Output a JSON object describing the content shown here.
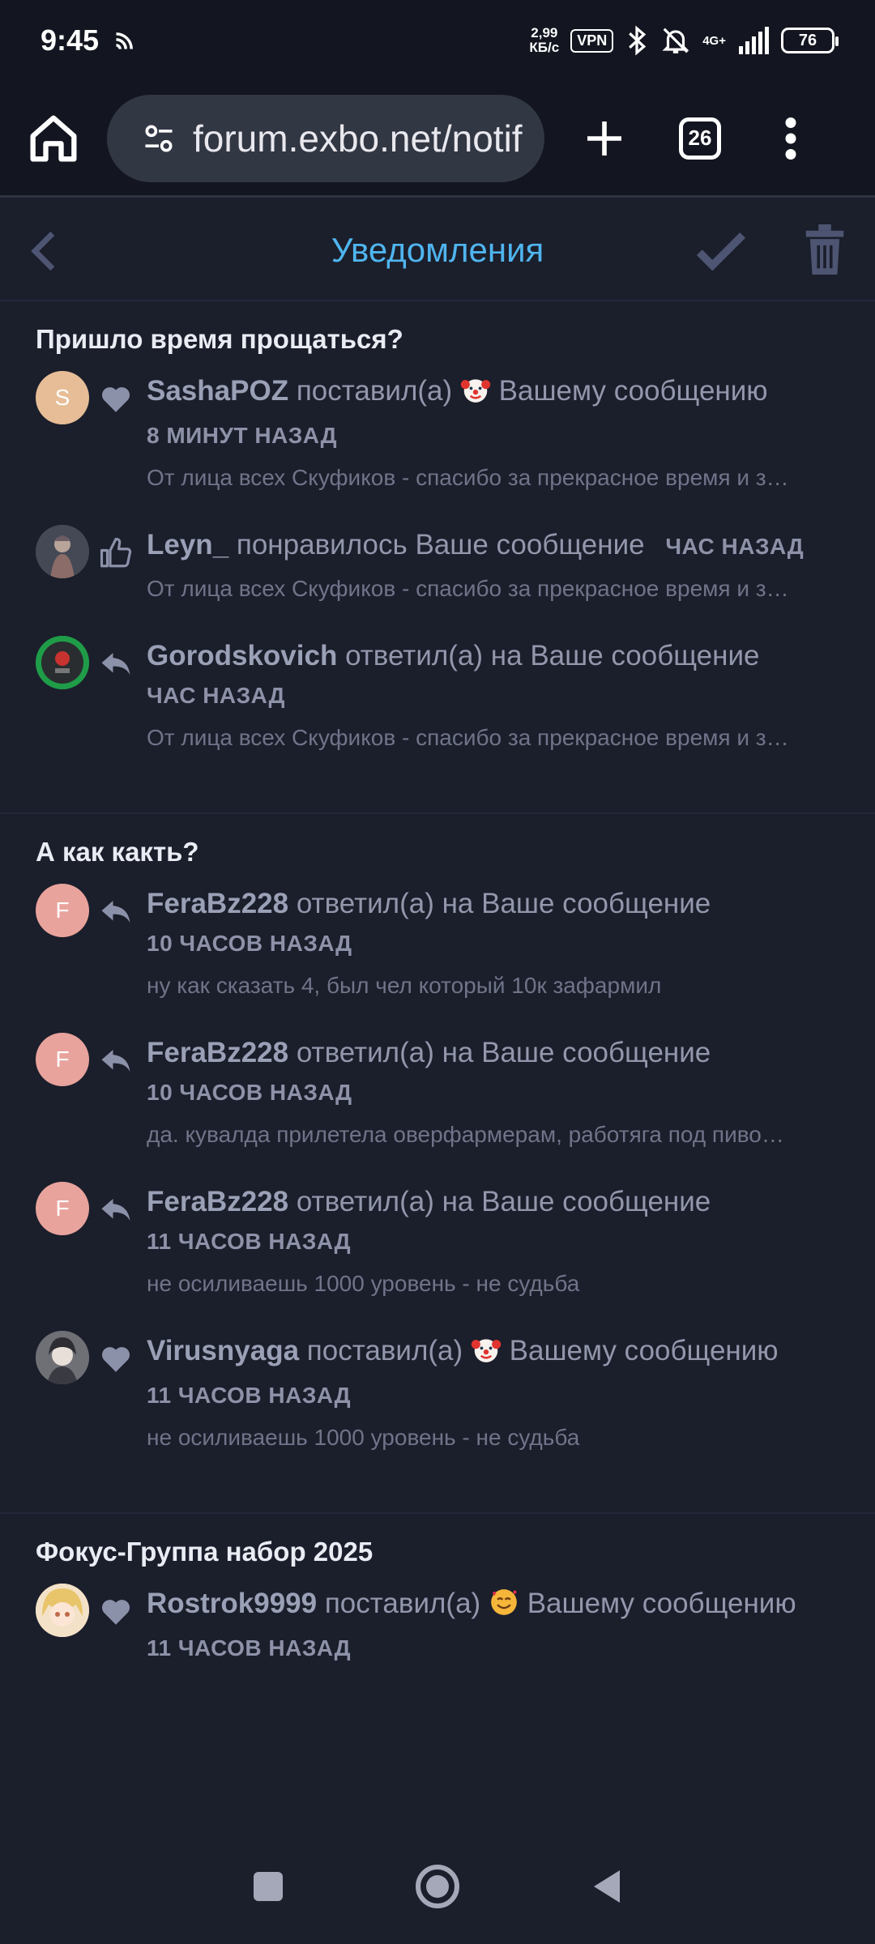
{
  "status_bar": {
    "time": "9:45",
    "speed_value": "2,99",
    "speed_unit": "КБ/с",
    "vpn": "VPN",
    "network": "4G+",
    "battery": "76"
  },
  "browser": {
    "url": "forum.exbo.net/notif",
    "tab_count": "26"
  },
  "header": {
    "title": "Уведомления"
  },
  "colors": {
    "accent": "#4fb5ef",
    "background": "#1b1e2b"
  },
  "groups": [
    {
      "title": "Пришло время прощаться?",
      "items": [
        {
          "user": "SashaPOZ",
          "action_before": "поставил(а)",
          "emoji": "clown",
          "action_after": "Вашему сообщению",
          "time": "8 минут назад",
          "excerpt": "От лица всех Скуфиков - спасибо за прекрасное время и з…",
          "icon": "heart-icon",
          "avatar_letter": "S"
        },
        {
          "user": "Leyn_",
          "action_before": "понравилось Ваше сообщение",
          "time": "час назад",
          "excerpt": "От лица всех Скуфиков - спасибо за прекрасное время и з…",
          "icon": "thumbs-up-icon"
        },
        {
          "user": "Gorodskovich",
          "action_before": "ответил(а) на Ваше сообщение",
          "time": "час назад",
          "excerpt": "От лица всех Скуфиков - спасибо за прекрасное время и з…",
          "icon": "reply-icon"
        }
      ]
    },
    {
      "title": "А как какть?",
      "items": [
        {
          "user": "FeraBz228",
          "action_before": "ответил(а) на Ваше сообщение",
          "time": "10 часов назад",
          "excerpt": "ну как сказать 4, был чел который 10к зафармил",
          "icon": "reply-icon",
          "avatar_letter": "F"
        },
        {
          "user": "FeraBz228",
          "action_before": "ответил(а) на Ваше сообщение",
          "time": "10 часов назад",
          "excerpt": "да. кувалда прилетела оверфармерам, работяга под пиво…",
          "icon": "reply-icon",
          "avatar_letter": "F"
        },
        {
          "user": "FeraBz228",
          "action_before": "ответил(а) на Ваше сообщение",
          "time": "11 часов назад",
          "excerpt": "не осиливаешь 1000 уровень - не судьба",
          "icon": "reply-icon",
          "avatar_letter": "F"
        },
        {
          "user": "Virusnyaga",
          "action_before": "поставил(а)",
          "emoji": "clown",
          "action_after": "Вашему сообщению",
          "time": "11 часов назад",
          "excerpt": "не осиливаешь 1000 уровень - не судьба",
          "icon": "heart-icon"
        }
      ]
    },
    {
      "title": "Фокус-Группа набор 2025",
      "items": [
        {
          "user": "Rostrok9999",
          "action_before": "поставил(а)",
          "emoji": "smiling-face-with-hearts",
          "action_after": "Вашему сообщению",
          "time": "11 часов назад",
          "icon": "heart-icon"
        }
      ]
    }
  ]
}
